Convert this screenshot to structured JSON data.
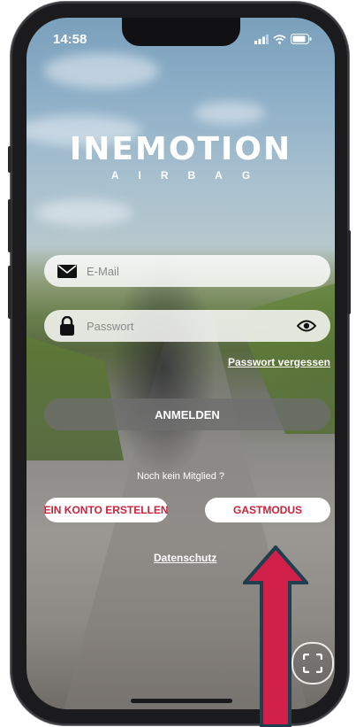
{
  "status_bar": {
    "time": "14:58",
    "icons": [
      "signal-icon",
      "wifi-icon",
      "battery-icon"
    ]
  },
  "logo": {
    "main": "INEMOTION",
    "sub": "AIRBAG"
  },
  "login_form": {
    "email_placeholder": "E-Mail",
    "email_value": "",
    "password_placeholder": "Passwort",
    "password_value": "",
    "forgot_password": "Passwort vergessen",
    "submit_label": "ANMELDEN"
  },
  "signup": {
    "prompt": "Noch kein Mitglied ?",
    "create_account_label": "EIN KONTO ERSTELLEN",
    "guest_label": "GASTMODUS"
  },
  "footer": {
    "privacy_label": "Datenschutz"
  },
  "colors": {
    "accent_red": "#c8243c",
    "arrow_outline": "#1f3f4f",
    "frame": "#1b1b1d"
  }
}
